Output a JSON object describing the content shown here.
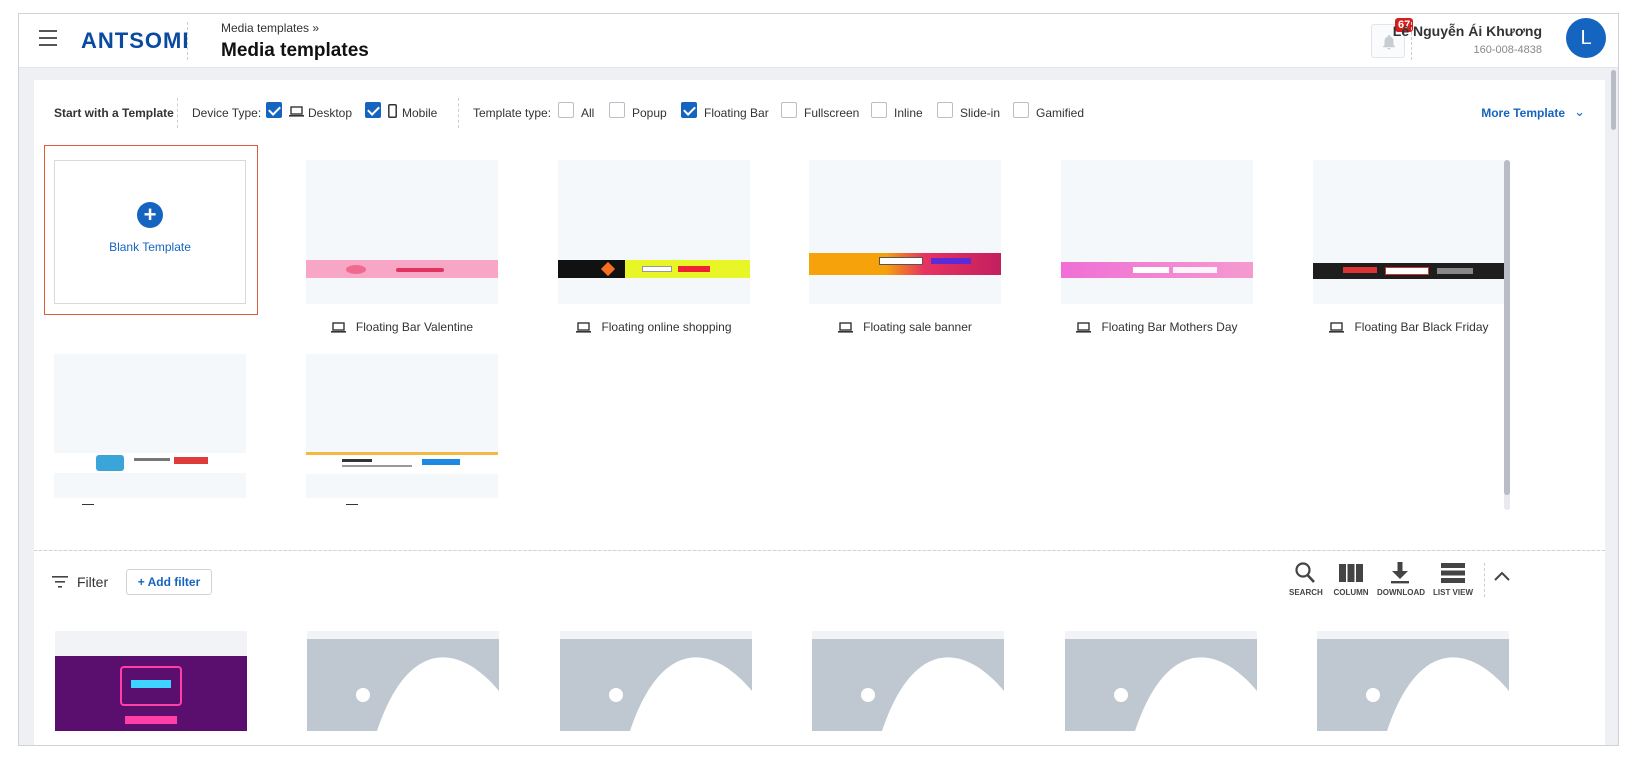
{
  "header": {
    "logo": "ANTSOMI",
    "breadcrumb": "Media templates »",
    "title": "Media templates",
    "notification_count": "67",
    "user_name": "Lê Nguyễn Ái Khương",
    "user_id": "160-008-4838",
    "avatar_initial": "L"
  },
  "toolbar": {
    "start_label": "Start with a Template",
    "device_label": "Device Type:",
    "devices": [
      {
        "label": "Desktop",
        "checked": true,
        "icon": "laptop-icon"
      },
      {
        "label": "Mobile",
        "checked": true,
        "icon": "mobile-icon"
      }
    ],
    "template_type_label": "Template type:",
    "template_types": [
      {
        "label": "All",
        "checked": false
      },
      {
        "label": "Popup",
        "checked": false
      },
      {
        "label": "Floating Bar",
        "checked": true
      },
      {
        "label": "Fullscreen",
        "checked": false
      },
      {
        "label": "Inline",
        "checked": false
      },
      {
        "label": "Slide-in",
        "checked": false
      },
      {
        "label": "Gamified",
        "checked": false
      }
    ],
    "more_template": "More Template"
  },
  "blank_template": {
    "label": "Blank Template"
  },
  "templates": [
    {
      "name": "Floating Bar Valentine",
      "bar_color": "#f7a7c5"
    },
    {
      "name": "Floating online shopping",
      "bar_color": "#e8f526"
    },
    {
      "name": "Floating sale banner",
      "bar_color": "#f5a20b"
    },
    {
      "name": "Floating Bar Mothers Day",
      "bar_color": "#f06fd5"
    },
    {
      "name": "Floating Bar Black Friday",
      "bar_color": "#1e1e1e"
    },
    {
      "name": "",
      "bar_color": "#ffffff"
    },
    {
      "name": "",
      "bar_color": "#ffffff"
    }
  ],
  "filter": {
    "label": "Filter",
    "add_filter": "Add filter",
    "tools": [
      {
        "label": "SEARCH",
        "icon": "search-icon"
      },
      {
        "label": "COLUMN",
        "icon": "column-icon"
      },
      {
        "label": "DOWNLOAD",
        "icon": "download-icon"
      },
      {
        "label": "LIST VIEW",
        "icon": "list-view-icon"
      }
    ]
  },
  "colors": {
    "primary": "#1565c0",
    "danger": "#d51f1f",
    "highlight_border": "#e05a3c"
  }
}
